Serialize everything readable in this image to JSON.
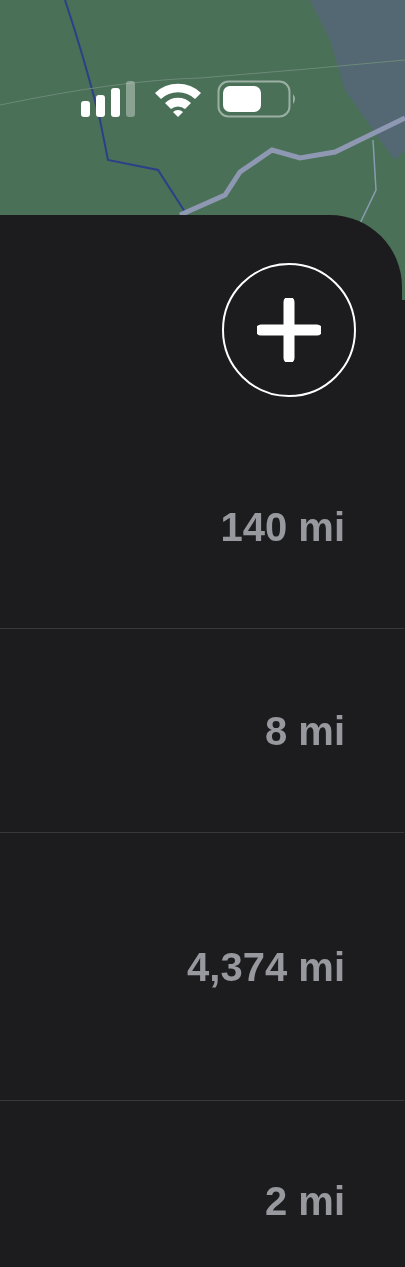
{
  "rows": [
    {
      "distance": "140 mi"
    },
    {
      "distance": "8 mi"
    },
    {
      "distance": "4,374 mi"
    },
    {
      "distance": "2 mi"
    }
  ]
}
